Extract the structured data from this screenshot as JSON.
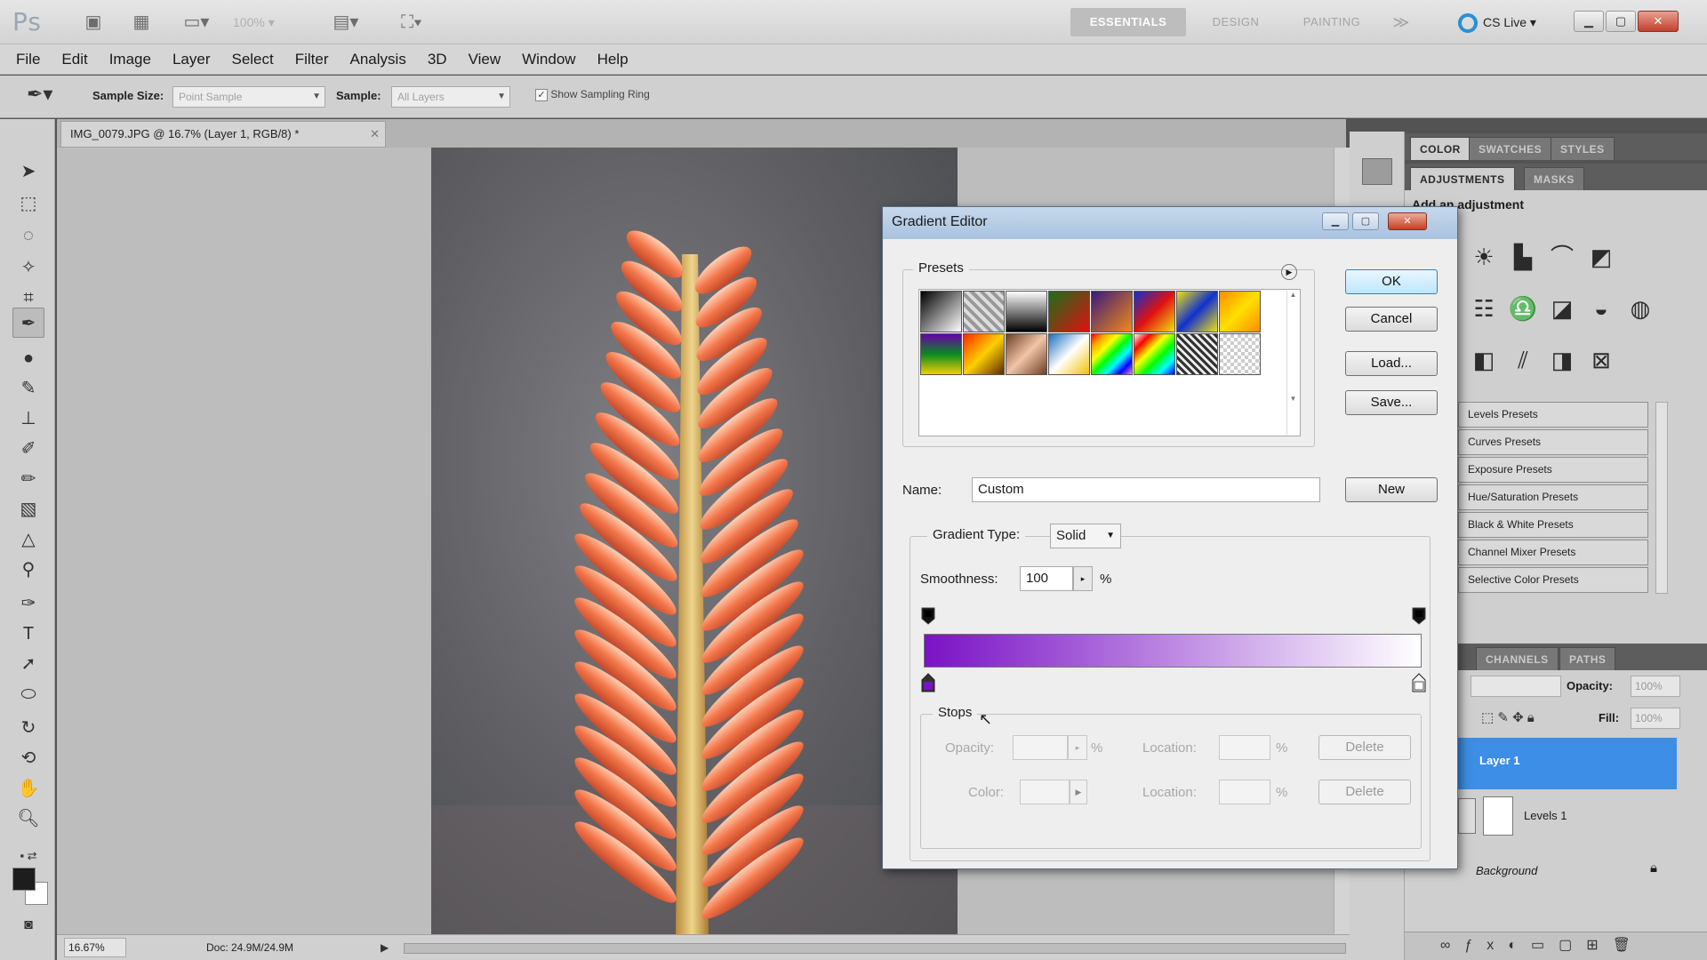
{
  "app": {
    "logo": "Ps",
    "zoom_value": "100%",
    "workspaces": [
      "ESSENTIALS",
      "DESIGN",
      "PAINTING",
      "≫"
    ],
    "cslive": "CS Live"
  },
  "menu": [
    "File",
    "Edit",
    "Image",
    "Layer",
    "Select",
    "Filter",
    "Analysis",
    "3D",
    "View",
    "Window",
    "Help"
  ],
  "options": {
    "sample_size_label": "Sample Size:",
    "sample_size_value": "Point Sample",
    "sample_label": "Sample:",
    "sample_value": "All Layers",
    "show_ring_label": "Show Sampling Ring"
  },
  "document": {
    "tab_title": "IMG_0079.JPG @ 16.7% (Layer 1, RGB/8) *",
    "status_zoom": "16.67%",
    "status_doc": "Doc: 24.9M/24.9M"
  },
  "panels": {
    "top_tabs": [
      "COLOR",
      "SWATCHES",
      "STYLES"
    ],
    "mid_tabs": [
      "ADJUSTMENTS",
      "MASKS"
    ],
    "adj_heading": "Add an adjustment",
    "preset_items": [
      "Levels Presets",
      "Curves Presets",
      "Exposure Presets",
      "Hue/Saturation Presets",
      "Black & White Presets",
      "Channel Mixer Presets",
      "Selective Color Presets"
    ],
    "layer_tabs": [
      "CHANNELS",
      "PATHS"
    ],
    "opacity_label": "Opacity:",
    "opacity_value": "100%",
    "fill_label": "Fill:",
    "fill_value": "100%",
    "layers": [
      "Layer 1",
      "Levels 1",
      "Background"
    ]
  },
  "dialog": {
    "title": "Gradient Editor",
    "presets_label": "Presets",
    "ok": "OK",
    "cancel": "Cancel",
    "load": "Load...",
    "save": "Save...",
    "name_label": "Name:",
    "name_value": "Custom",
    "new_button": "New",
    "gradient_type_label": "Gradient Type:",
    "gradient_type_value": "Solid",
    "smoothness_label": "Smoothness:",
    "smoothness_value": "100",
    "percent": "%",
    "stops_label": "Stops",
    "opacity_label": "Opacity:",
    "color_label": "Color:",
    "location_label": "Location:",
    "delete": "Delete",
    "gradient_start_color": "#7a12c6",
    "gradient_end_color": "#ffffff"
  }
}
